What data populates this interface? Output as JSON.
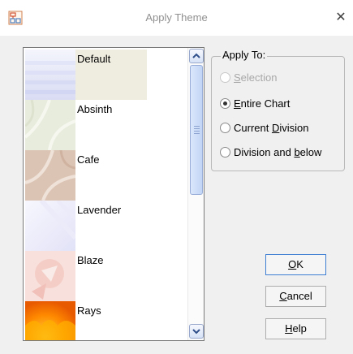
{
  "window": {
    "title": "Apply Theme",
    "close_glyph": "✕",
    "icon": "chart-app-icon"
  },
  "theme_list": {
    "selected": "Default",
    "items": [
      {
        "label": "Default"
      },
      {
        "label": "Absinth"
      },
      {
        "label": "Cafe"
      },
      {
        "label": "Lavender"
      },
      {
        "label": "Blaze"
      },
      {
        "label": "Rays"
      }
    ]
  },
  "apply_to": {
    "legend": "Apply To:",
    "options": [
      {
        "pre": "",
        "key": "S",
        "post": "election",
        "state": "disabled"
      },
      {
        "pre": "",
        "key": "E",
        "post": "ntire Chart",
        "state": "checked"
      },
      {
        "pre": "Current ",
        "key": "D",
        "post": "ivision",
        "state": "unchecked"
      },
      {
        "pre": "Division and ",
        "key": "b",
        "post": "elow",
        "state": "unchecked"
      }
    ]
  },
  "buttons": {
    "ok": {
      "pre": "",
      "key": "O",
      "post": "K"
    },
    "cancel": {
      "pre": "",
      "key": "C",
      "post": "ancel"
    },
    "help": {
      "pre": "",
      "key": "H",
      "post": "elp"
    }
  },
  "colors": {
    "list_selection": "#efece0",
    "default_button_border": "#3f7fd3",
    "scrollbar_thumb": "#c2d5f5"
  }
}
